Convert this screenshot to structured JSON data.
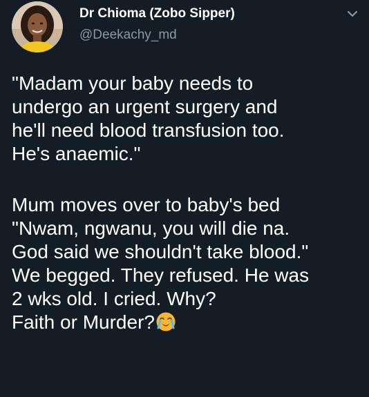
{
  "tweet": {
    "author": {
      "display_name": "Dr Chioma (Zobo Sipper)",
      "handle": "@Deekachy_md",
      "avatar_icon": "profile-photo",
      "menu_icon": "chevron-down-icon"
    },
    "paragraph1": [
      "\"Madam your baby needs to",
      "undergo an urgent surgery and",
      "he'll need blood transfusion too.",
      "He's anaemic.\""
    ],
    "paragraph2": [
      "Mum moves over to baby's bed",
      "\"Nwam, ngwanu,  you will die na.",
      "God said we shouldn't take blood.\"",
      "We begged. They refused. He was",
      "2 wks old. I cried. Why?",
      "Faith or Murder?"
    ],
    "end_emoji": "crying-face-emoji"
  },
  "colors": {
    "background": "#141d26",
    "text": "#ffffff",
    "secondary_text": "#8899a6",
    "emoji": "#f5b731"
  }
}
